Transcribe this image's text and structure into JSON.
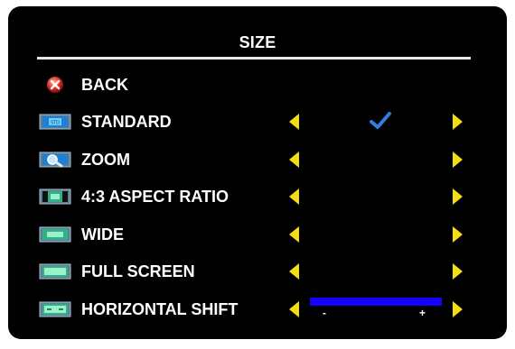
{
  "menu": {
    "title": "SIZE",
    "items": [
      {
        "label": "BACK",
        "icon": "back-icon"
      },
      {
        "label": "STANDARD",
        "icon": "standard-size-icon",
        "selected": true
      },
      {
        "label": "ZOOM",
        "icon": "zoom-icon"
      },
      {
        "label": "4:3 ASPECT RATIO",
        "icon": "aspect-ratio-icon"
      },
      {
        "label": "WIDE",
        "icon": "wide-icon"
      },
      {
        "label": "FULL SCREEN",
        "icon": "full-screen-icon"
      },
      {
        "label": "HORIZONTAL SHIFT",
        "icon": "horizontal-shift-icon"
      }
    ],
    "horizontal_shift": {
      "minus_label": "-",
      "plus_label": "+",
      "level": 1.0
    },
    "colors": {
      "background": "#000000",
      "text": "#ffffff",
      "arrow": "#f4dd12",
      "check": "#2f7fe0",
      "slider": "#1400ff"
    }
  }
}
